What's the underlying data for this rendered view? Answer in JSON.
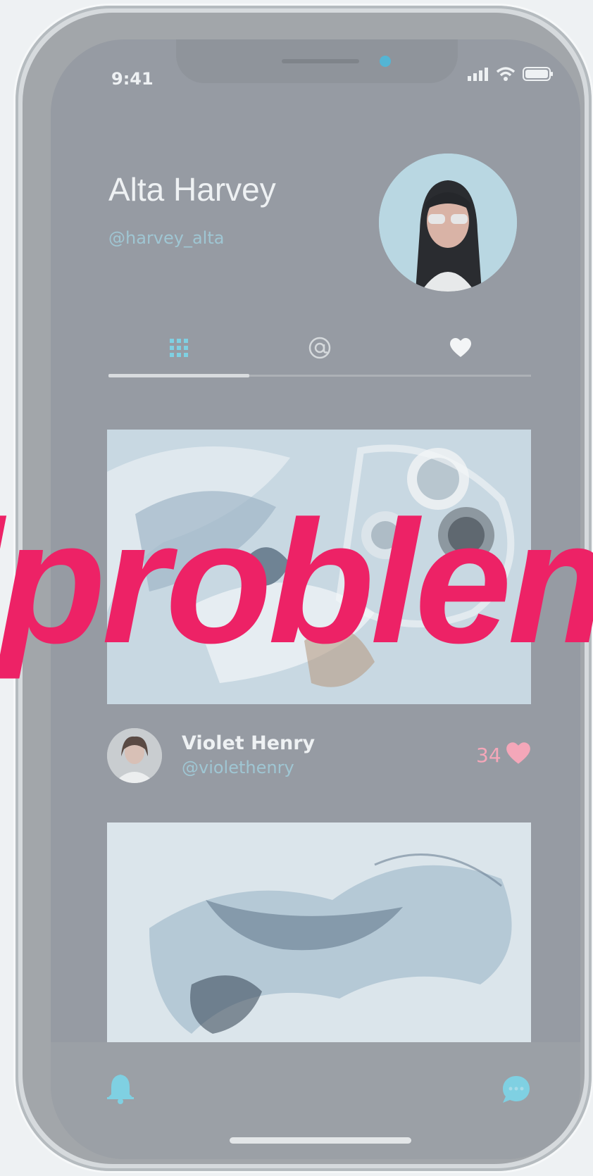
{
  "status_bar": {
    "time": "9:41",
    "icons": [
      "signal-icon",
      "wifi-icon",
      "battery-icon"
    ]
  },
  "profile": {
    "name": "Alta Harvey",
    "handle": "@harvey_alta"
  },
  "tabs": [
    {
      "icon": "grid-icon",
      "active": true
    },
    {
      "icon": "at-sign-icon",
      "active": false
    },
    {
      "icon": "heart-icon",
      "active": false
    }
  ],
  "post": {
    "author_name": "Violet Henry",
    "author_handle": "@violethenry",
    "likes": "34"
  },
  "bottom_bar": {
    "icons": [
      "bell-icon",
      "chat-icon"
    ]
  },
  "overlay": {
    "text": "lproblem"
  },
  "colors": {
    "accent": "#54b5d4",
    "like": "#f4a7b9",
    "overlay": "#ed2266",
    "screen": "#969ba3"
  }
}
